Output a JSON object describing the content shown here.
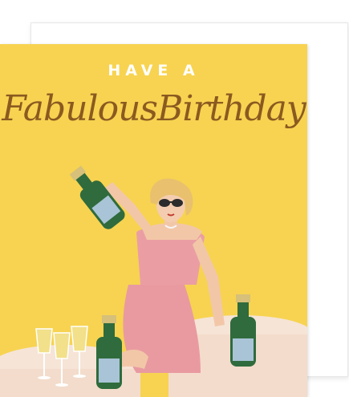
{
  "card": {
    "greeting_top": "HAVE A",
    "greeting_script": "FabulousBirthday"
  },
  "colors": {
    "background": "#f7d351",
    "script_text": "#8a5a20",
    "dress": "#e99aa0",
    "bottle": "#2f6b3d",
    "bottle_label": "#a9c4d6",
    "champagne": "#f2e08a",
    "table": "#f6e4d6"
  }
}
